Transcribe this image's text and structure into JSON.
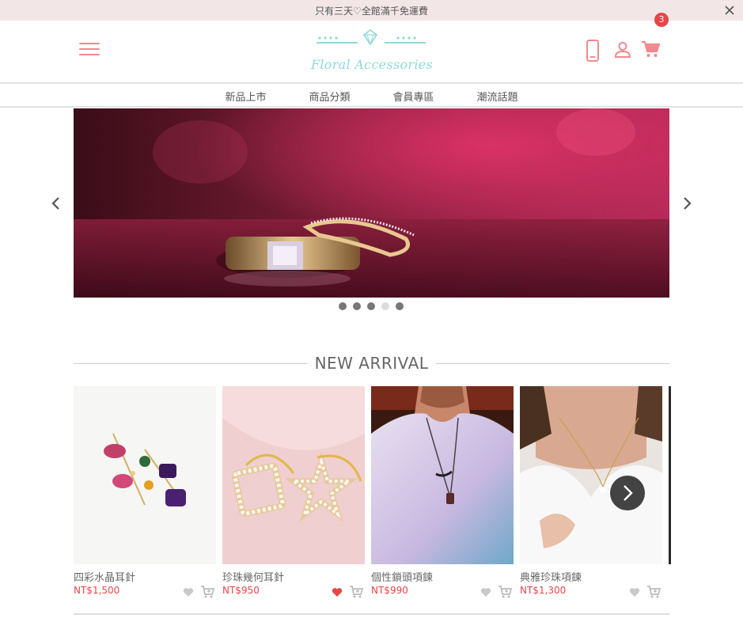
{
  "announcement": {
    "text": "只有三天♡全館滿千免運費"
  },
  "header": {
    "logo_text": "Floral Accessories",
    "cart_count": "3"
  },
  "nav": {
    "items": [
      "新品上市",
      "商品分類",
      "會員專區",
      "潮流話題"
    ]
  },
  "banner": {
    "slide_count": 5,
    "active_slide": 4
  },
  "section": {
    "title": "NEW ARRIVAL"
  },
  "products": [
    {
      "name": "四彩水晶耳針",
      "price": "NT$1,500",
      "liked": false
    },
    {
      "name": "珍珠幾何耳針",
      "price": "NT$950",
      "liked": true
    },
    {
      "name": "個性鎖頭項鍊",
      "price": "NT$990",
      "liked": false
    },
    {
      "name": "典雅珍珠項鍊",
      "price": "NT$1,300",
      "liked": false
    }
  ],
  "colors": {
    "accent_pink": "#f2898f",
    "price_red": "#e84548",
    "logo_teal": "#8fd8d8",
    "announce_bg": "#f3e6e7"
  },
  "icons": [
    "close-icon",
    "hamburger-icon",
    "diamond-icon",
    "phone-icon",
    "user-icon",
    "cart-icon",
    "chevron-left-icon",
    "chevron-right-icon",
    "heart-icon",
    "add-to-cart-icon"
  ]
}
